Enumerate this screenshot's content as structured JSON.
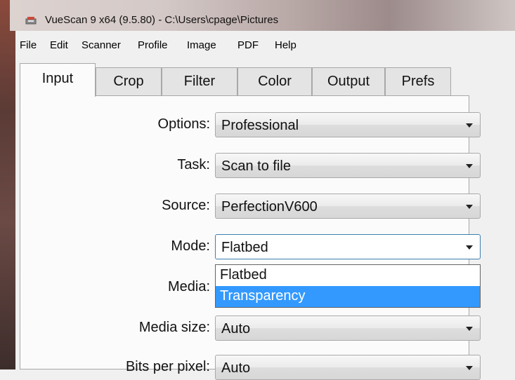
{
  "window": {
    "title": "VueScan 9 x64 (9.5.80) - C:\\Users\\cpage\\Pictures"
  },
  "menu": [
    "File",
    "Edit",
    "Scanner",
    "Profile",
    "Image",
    "PDF",
    "Help"
  ],
  "tabs": [
    "Input",
    "Crop",
    "Filter",
    "Color",
    "Output",
    "Prefs"
  ],
  "active_tab": "Input",
  "form": {
    "options": {
      "label": "Options:",
      "value": "Professional"
    },
    "task": {
      "label": "Task:",
      "value": "Scan to file"
    },
    "source": {
      "label": "Source:",
      "value": "PerfectionV600"
    },
    "mode": {
      "label": "Mode:",
      "value": "Flatbed"
    },
    "media": {
      "label": "Media:"
    },
    "media_size": {
      "label": "Media size:",
      "value": "Auto"
    },
    "bits_per_pixel": {
      "label": "Bits per pixel:",
      "value": "Auto"
    }
  },
  "mode_dropdown": {
    "options": [
      "Flatbed",
      "Transparency"
    ],
    "highlighted": "Transparency"
  },
  "colors": {
    "highlight": "#3399ff",
    "focus_border": "#3c7fb1"
  }
}
